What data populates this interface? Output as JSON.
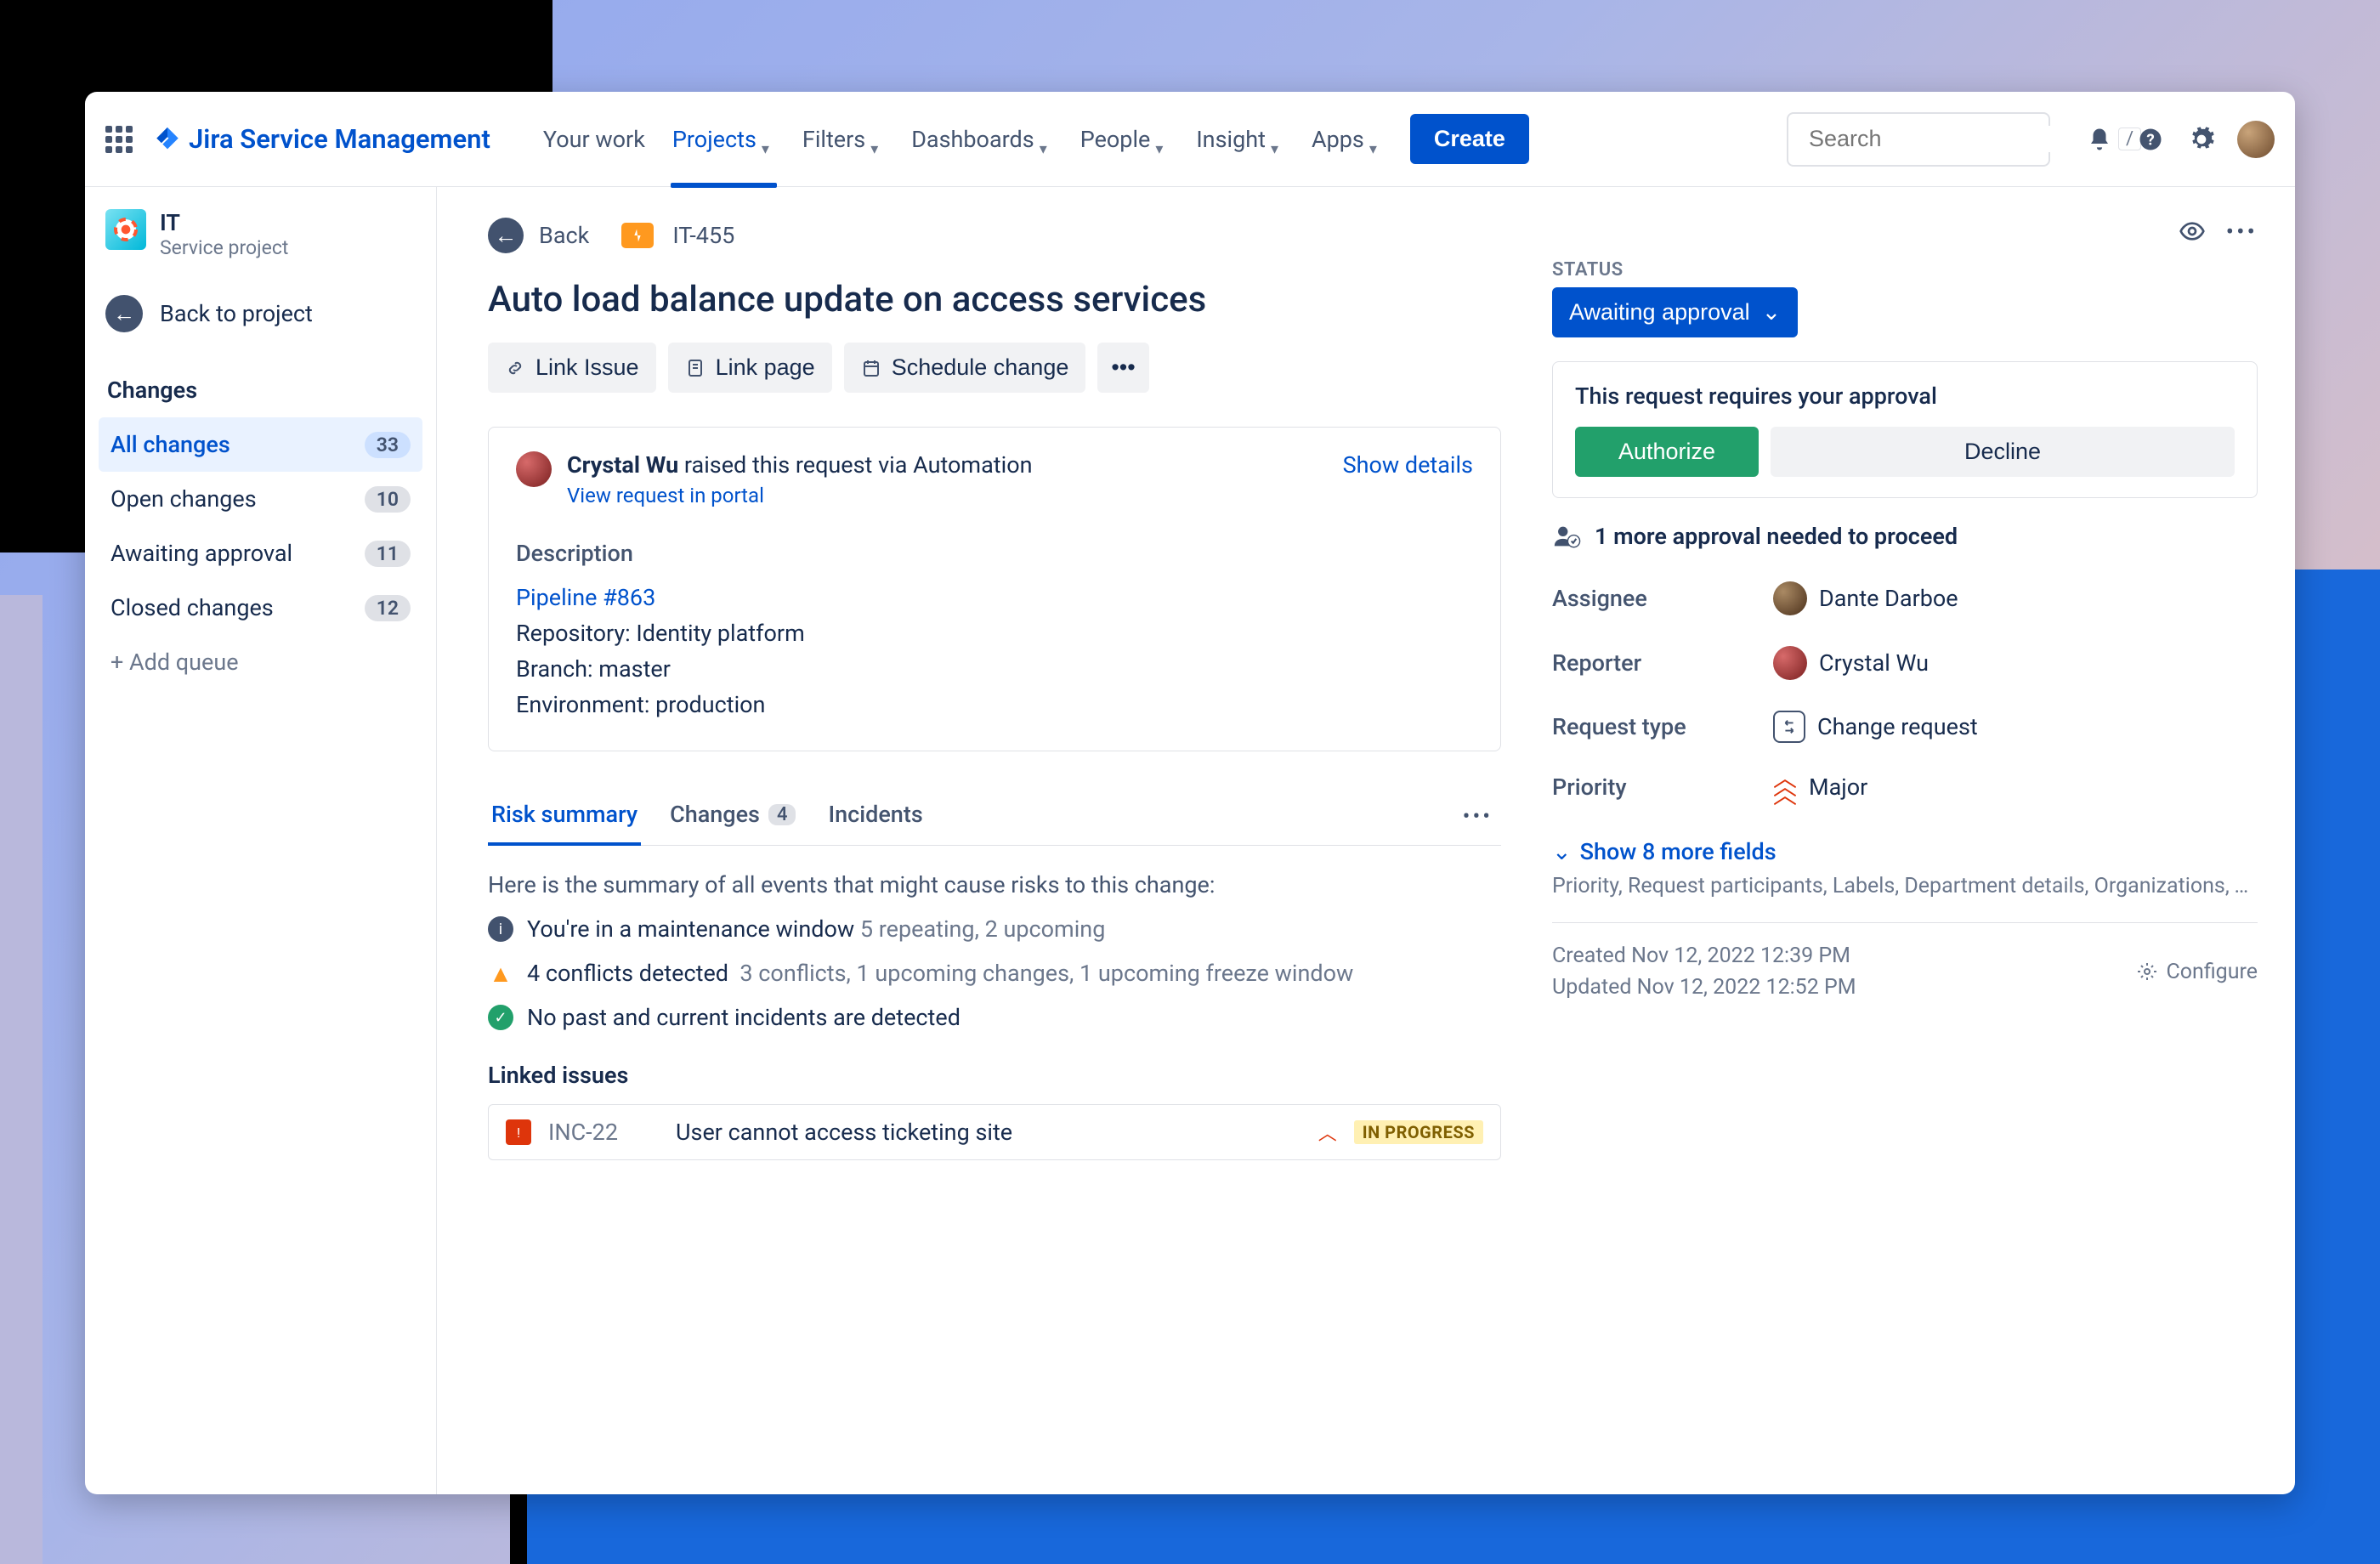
{
  "header": {
    "product": "Jira Service Management",
    "nav": {
      "your_work": "Your work",
      "projects": "Projects",
      "filters": "Filters",
      "dashboards": "Dashboards",
      "people": "People",
      "insight": "Insight",
      "apps": "Apps"
    },
    "create": "Create",
    "search_placeholder": "Search",
    "search_kbd": "/"
  },
  "sidebar": {
    "project_name": "IT",
    "project_type": "Service project",
    "back_to_project": "Back to project",
    "section": "Changes",
    "queues": [
      {
        "label": "All changes",
        "count": "33"
      },
      {
        "label": "Open changes",
        "count": "10"
      },
      {
        "label": "Awaiting approval",
        "count": "11"
      },
      {
        "label": "Closed changes",
        "count": "12"
      }
    ],
    "add_queue": "+ Add queue"
  },
  "breadcrumb": {
    "back": "Back",
    "key": "IT-455"
  },
  "issue": {
    "title": "Auto load balance update on access services",
    "actions": {
      "link_issue": "Link Issue",
      "link_page": "Link page",
      "schedule": "Schedule change"
    },
    "request_by_name": "Crystal Wu",
    "request_suffix": " raised this request via Automation",
    "view_portal": "View request in portal",
    "show_details": "Show details",
    "description_label": "Description",
    "pipeline": "Pipeline #863",
    "repo": "Repository: Identity platform",
    "branch": "Branch: master",
    "env": "Environment: production"
  },
  "tabs": {
    "risk": "Risk summary",
    "changes": "Changes",
    "changes_count": "4",
    "incidents": "Incidents"
  },
  "risk": {
    "intro": "Here is the summary of all events that might cause risks to this change:",
    "r1": "You're in a maintenance window",
    "r1sub": "5 repeating, 2 upcoming",
    "r2": "4 conflicts detected",
    "r2sub": "3 conflicts, 1 upcoming changes, 1 upcoming freeze window",
    "r3": "No past and current incidents are detected"
  },
  "linked": {
    "header": "Linked issues",
    "key": "INC-22",
    "summary": "User cannot access ticketing site",
    "status": "IN PROGRESS"
  },
  "rail": {
    "status_label": "STATUS",
    "status_value": "Awaiting approval",
    "approval_header": "This request requires your approval",
    "authorize": "Authorize",
    "decline": "Decline",
    "approval_note": "1 more approval needed to proceed",
    "fields": {
      "assignee_l": "Assignee",
      "assignee_v": "Dante Darboe",
      "reporter_l": "Reporter",
      "reporter_v": "Crystal Wu",
      "reqtype_l": "Request type",
      "reqtype_v": "Change request",
      "priority_l": "Priority",
      "priority_v": "Major"
    },
    "show_more": "Show 8 more fields",
    "more_list": "Priority, Request participants, Labels, Department details, Organizations, T...",
    "created": "Created Nov 12, 2022 12:39 PM",
    "updated": "Updated Nov 12, 2022 12:52 PM",
    "configure": "Configure"
  }
}
